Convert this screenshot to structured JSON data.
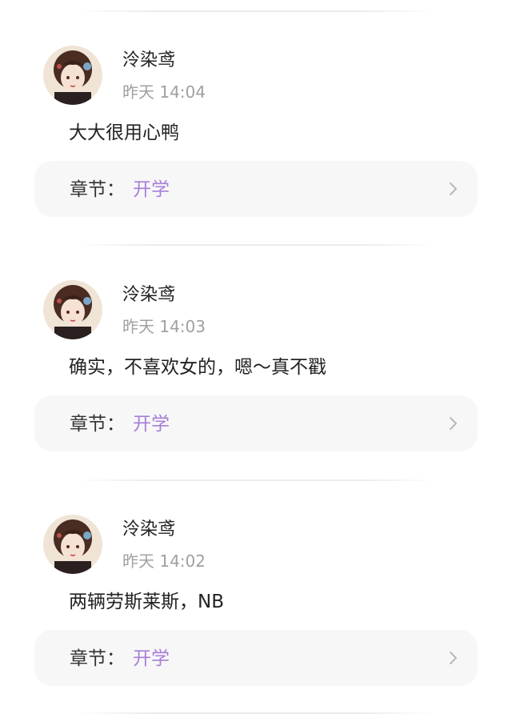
{
  "comments": [
    {
      "user": "泠染鸢",
      "time": "昨天 14:04",
      "text": "大大很用心鸭",
      "chapter_prefix": "章节：",
      "chapter_title": "开学"
    },
    {
      "user": "泠染鸢",
      "time": "昨天 14:03",
      "text": "确实，不喜欢女的，嗯～真不戳",
      "chapter_prefix": "章节：",
      "chapter_title": "开学"
    },
    {
      "user": "泠染鸢",
      "time": "昨天 14:02",
      "text": "两辆劳斯莱斯，NB",
      "chapter_prefix": "章节：",
      "chapter_title": "开学"
    }
  ],
  "icons": {
    "chevron": "chevron-right-icon",
    "avatar": "avatar"
  },
  "colors": {
    "accent": "#a77fd8",
    "card_bg": "#f7f7f8",
    "muted_text": "#a0a0a0"
  }
}
